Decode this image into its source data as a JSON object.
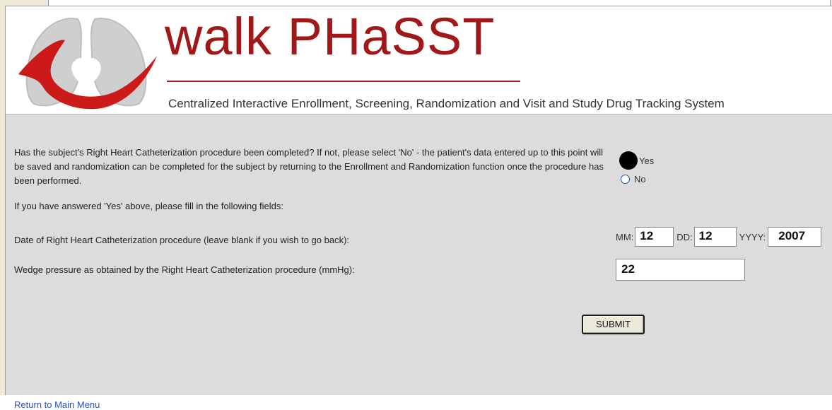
{
  "branding": {
    "title": "walk PHaSST",
    "tagline": "Centralized Interactive Enrollment, Screening, Randomization and Visit and Study Drug Tracking System"
  },
  "form": {
    "question": "Has the subject's Right Heart Catheterization procedure been completed? If not, please select 'No' - the patient's data entered up to this point will be saved and randomization can be completed for the subject by returning to the Enrollment and Randomization function once the procedure has been performed.",
    "options": [
      {
        "label": "Yes",
        "selected": true
      },
      {
        "label": "No",
        "selected": false
      }
    ],
    "instruction": "If you have answered 'Yes' above, please fill in the following fields:",
    "date_field": {
      "label": "Date of Right Heart Catheterization procedure (leave blank if you wish to go back):",
      "mm_label": "MM:",
      "mm_value": "12",
      "dd_label": "DD:",
      "dd_value": "12",
      "yyyy_label": "YYYY:",
      "yyyy_value": "2007"
    },
    "wedge_field": {
      "label": "Wedge pressure as obtained by the Right Heart Catheterization procedure (mmHg):",
      "value": "22"
    },
    "submit_label": "SUBMIT"
  },
  "footer": {
    "return_link": "Return to Main Menu"
  },
  "colors": {
    "brand_red": "#a01818",
    "panel_bg": "#dcdcdc",
    "link_blue": "#2c4fc4"
  }
}
